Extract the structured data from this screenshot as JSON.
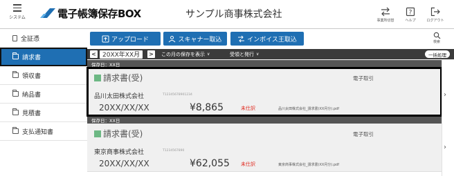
{
  "header": {
    "menu_label": "システム",
    "logo_text": "電子帳簿保存BOX",
    "company_name": "サンプル商事株式会社",
    "icons": [
      {
        "name": "switch-office-icon",
        "label": "事業所切替"
      },
      {
        "name": "help-icon",
        "label": "ヘルプ"
      },
      {
        "name": "logout-icon",
        "label": "ログアウト"
      }
    ]
  },
  "sidebar": {
    "items": [
      {
        "label": "全証憑",
        "icon": "document-icon",
        "active": false
      },
      {
        "label": "請求書",
        "icon": "folder-icon",
        "active": true
      },
      {
        "label": "領収書",
        "icon": "folder-icon",
        "active": false
      },
      {
        "label": "納品書",
        "icon": "folder-icon",
        "active": false
      },
      {
        "label": "見積書",
        "icon": "folder-icon",
        "active": false
      },
      {
        "label": "支払通知書",
        "icon": "folder-icon",
        "active": false
      }
    ]
  },
  "toolbar": {
    "upload_label": "アップロード",
    "scanner_label": "スキャナー取込",
    "invoice_king_label": "インボイス王取込",
    "search_label": "検索",
    "accent_color": "#1f6fb3"
  },
  "filter": {
    "prev_symbol": "<",
    "next_symbol": ">",
    "month": "20XX年XX月",
    "display_option": "この月の保存を表示",
    "sort_option": "受領と発行",
    "bulk_action": "一括処理"
  },
  "groups": [
    {
      "date_label": "保存日：XX日",
      "doc_type": "請求書(受)",
      "transaction_type": "電子取引",
      "client": "品川太田株式会社",
      "minor_text": "T12345678901234",
      "date": "20XX/XX/XX",
      "amount": "¥8,865",
      "status": "未仕訳",
      "file_name": "品川太田株式会社_請求書(XX月分).pdf",
      "selected": true
    },
    {
      "date_label": "保存日：XX日",
      "doc_type": "請求書(受)",
      "transaction_type": "電子取引",
      "client": "東京商事株式会社",
      "minor_text": "T1234567890",
      "date": "20XX/XX/XX",
      "amount": "¥62,055",
      "status": "未仕訳",
      "file_name": "東京商事株式会社_請求書(XX月分).pdf",
      "selected": false
    }
  ],
  "colors": {
    "status_unjournaled": "#e0261b",
    "doc_type_marker": "#6db884",
    "filter_bar": "#3b3b3b"
  }
}
